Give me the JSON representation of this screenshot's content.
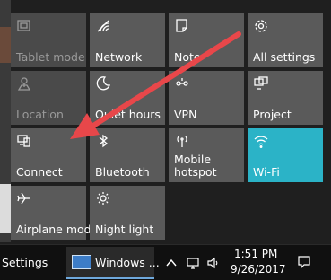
{
  "tiles": {
    "tablet_mode": "Tablet mode",
    "network": "Network",
    "note": "Note",
    "all_settings": "All settings",
    "location": "Location",
    "quiet_hours": "Quiet hours",
    "vpn": "VPN",
    "project": "Project",
    "connect": "Connect",
    "bluetooth": "Bluetooth",
    "mobile_hotspot": "Mobile hotspot",
    "wifi": "Wi-Fi",
    "airplane_mode": "Airplane mode",
    "night_light": "Night light"
  },
  "taskbar": {
    "settings_label": "Settings",
    "app_label": "Windows ...",
    "time": "1:51 PM",
    "date": "9/26/2017"
  },
  "colors": {
    "tile": "#5a5a5a",
    "tile_disabled": "#4a4a4a",
    "active": "#2bb3c7",
    "arrow": "#e8474a"
  },
  "icons": [
    "tablet-mode-icon",
    "network-icon",
    "note-icon",
    "gear-icon",
    "location-icon",
    "moon-icon",
    "vpn-icon",
    "project-icon",
    "connect-icon",
    "bluetooth-icon",
    "hotspot-icon",
    "wifi-icon",
    "airplane-icon",
    "brightness-icon",
    "chevron-up-icon",
    "network-tray-icon",
    "volume-icon",
    "notification-icon"
  ]
}
